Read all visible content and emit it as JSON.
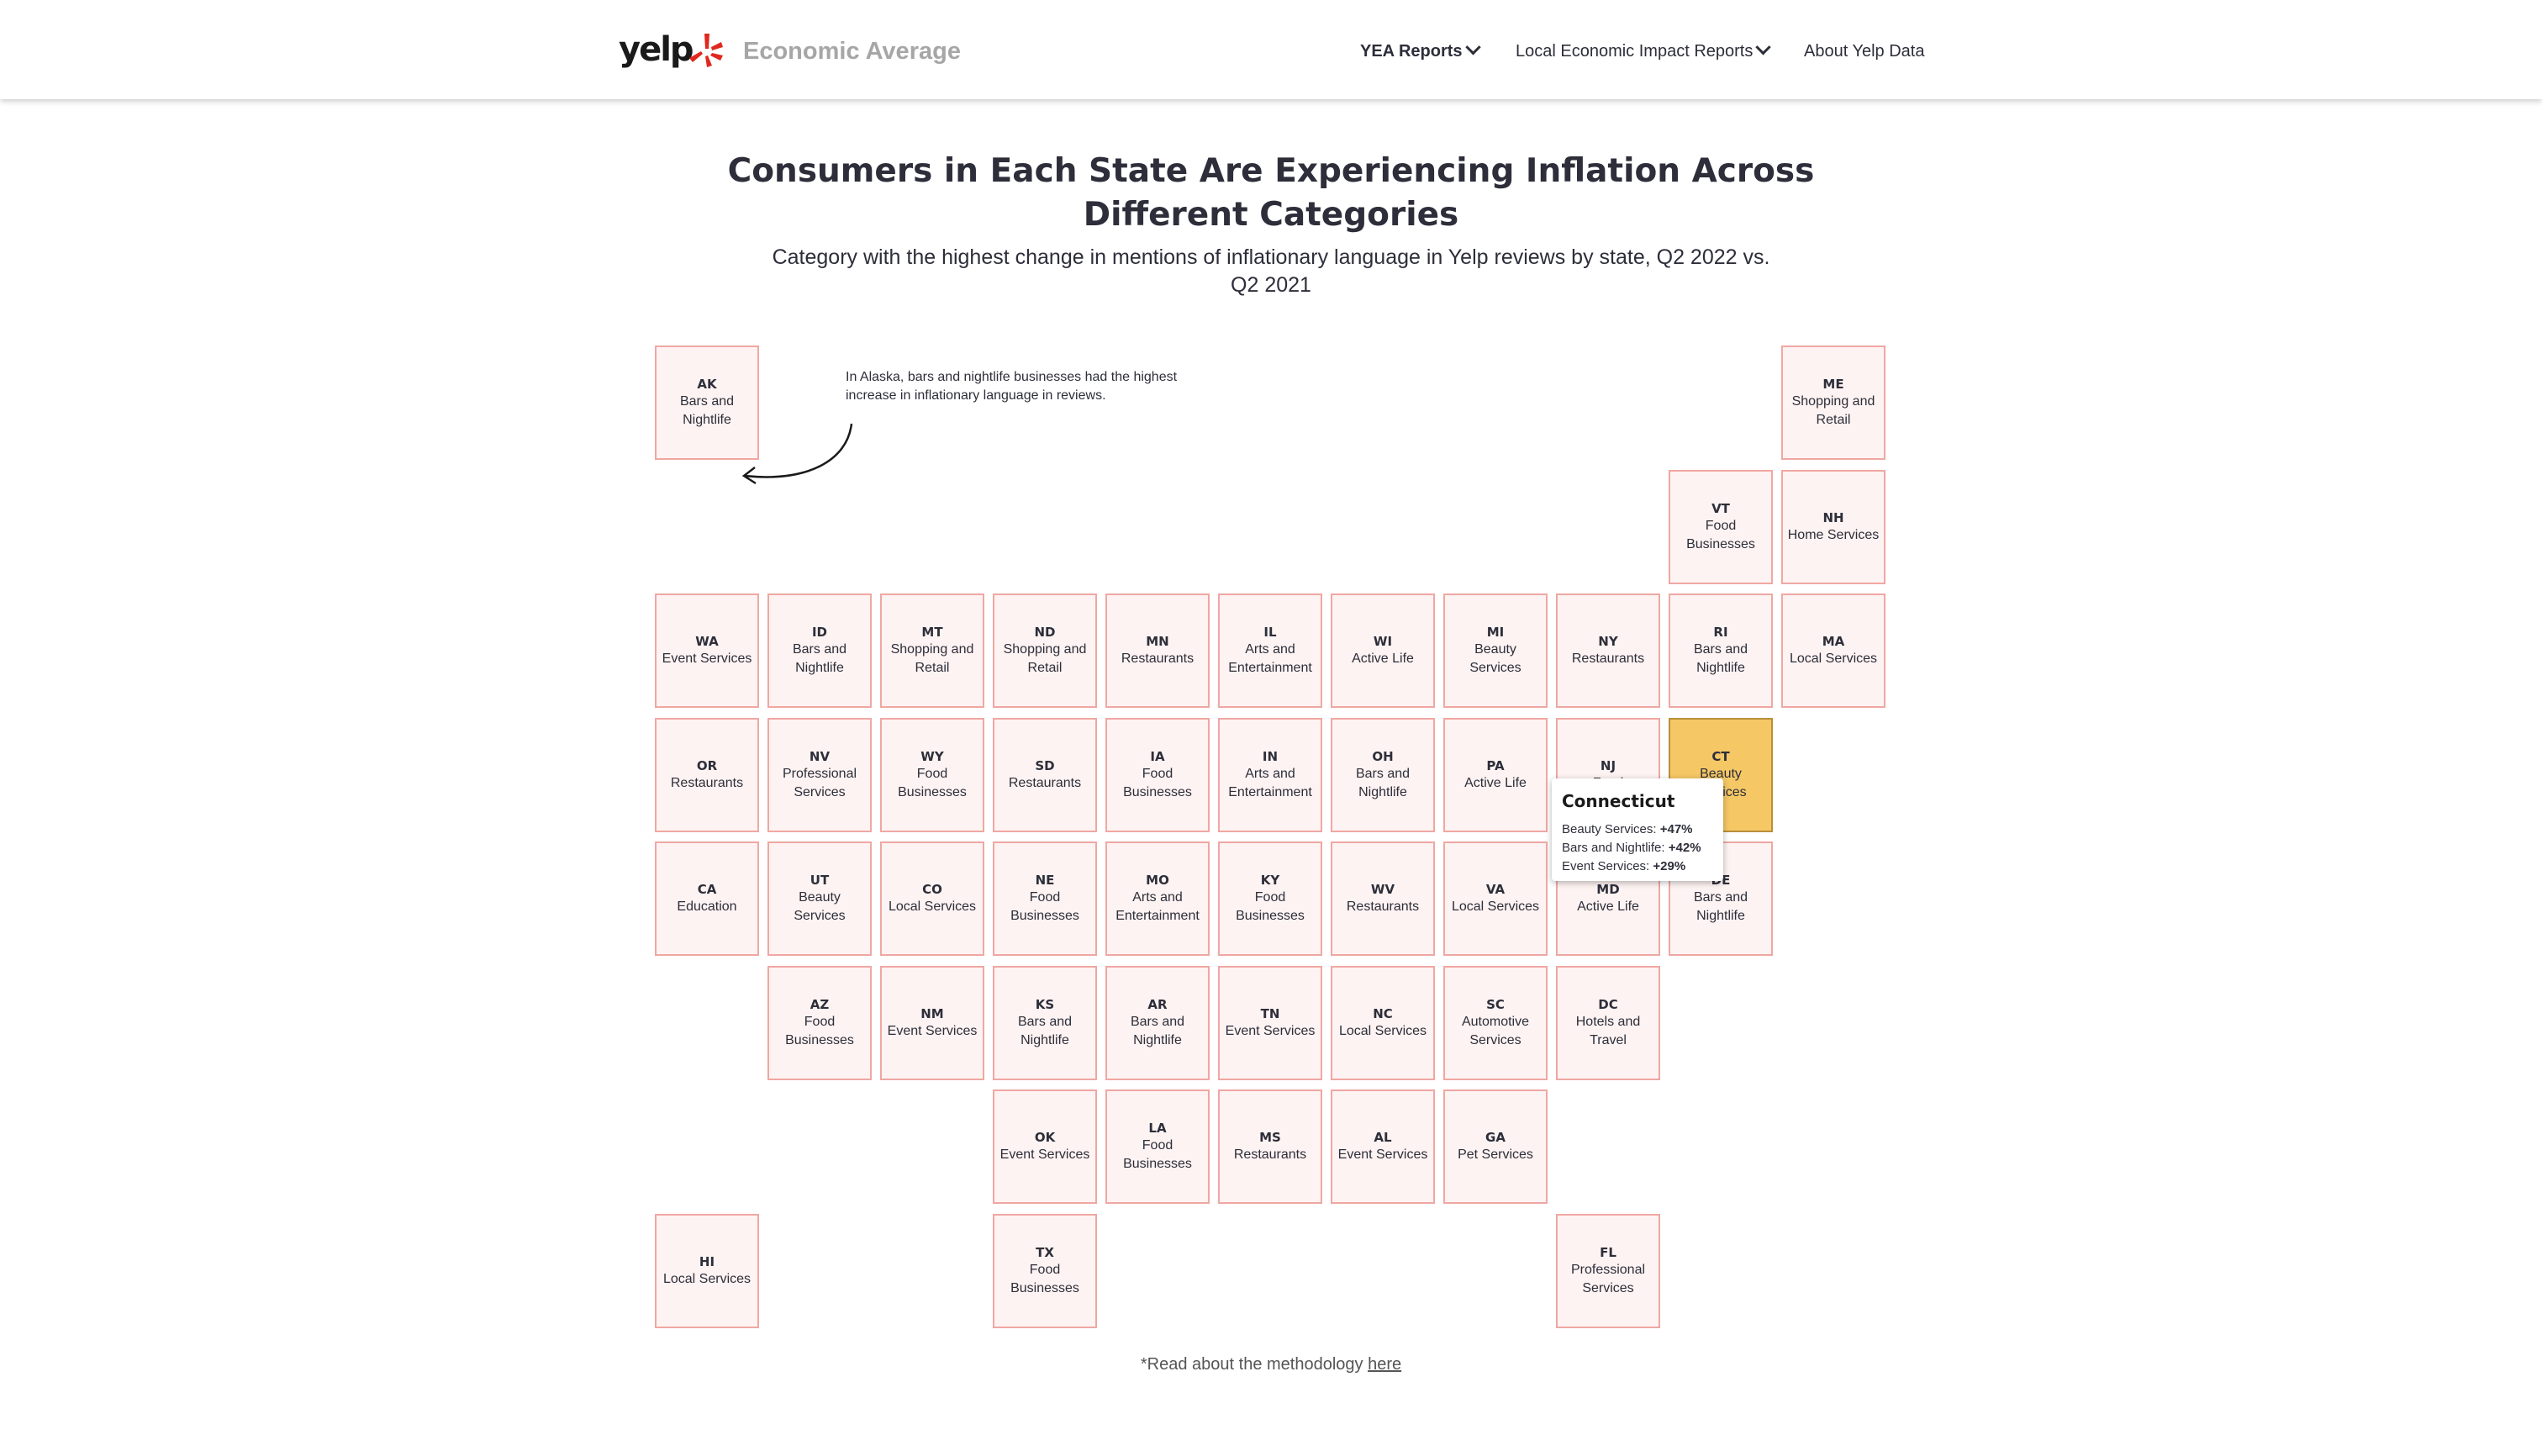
{
  "header": {
    "logo_text": "yelp",
    "site_name": "Economic Average",
    "nav": [
      {
        "label": "YEA Reports"
      },
      {
        "label": "Local Economic Impact Reports"
      },
      {
        "label": "About Yelp Data"
      }
    ]
  },
  "title": "Consumers in Each State Are Experiencing Inflation Across Different Categories",
  "subtitle": "Category with the highest change in mentions of inflationary language in Yelp reviews by state, Q2 2022 vs. Q2 2021",
  "annotation": "In Alaska, bars and nightlife businesses had the highest increase in inflationary language in reviews.",
  "colors": {
    "tile_fill": "#fdf3f2",
    "tile_border": "#f0a7a2",
    "active_fill": "#f5c865",
    "brand_red": "#e0281f"
  },
  "states": [
    {
      "abbr": "AK",
      "category": "Bars and Nightlife"
    },
    {
      "abbr": "ME",
      "category": "Shopping and Retail"
    },
    {
      "abbr": "VT",
      "category": "Food Businesses"
    },
    {
      "abbr": "NH",
      "category": "Home Services"
    },
    {
      "abbr": "WA",
      "category": "Event Services"
    },
    {
      "abbr": "ID",
      "category": "Bars and Nightlife"
    },
    {
      "abbr": "MT",
      "category": "Shopping and Retail"
    },
    {
      "abbr": "ND",
      "category": "Shopping and Retail"
    },
    {
      "abbr": "MN",
      "category": "Restaurants"
    },
    {
      "abbr": "IL",
      "category": "Arts and Entertainment"
    },
    {
      "abbr": "WI",
      "category": "Active Life"
    },
    {
      "abbr": "MI",
      "category": "Beauty Services"
    },
    {
      "abbr": "NY",
      "category": "Restaurants"
    },
    {
      "abbr": "RI",
      "category": "Bars and Nightlife"
    },
    {
      "abbr": "MA",
      "category": "Local Services"
    },
    {
      "abbr": "OR",
      "category": "Restaurants"
    },
    {
      "abbr": "NV",
      "category": "Professional Services"
    },
    {
      "abbr": "WY",
      "category": "Food Businesses"
    },
    {
      "abbr": "SD",
      "category": "Restaurants"
    },
    {
      "abbr": "IA",
      "category": "Food Businesses"
    },
    {
      "abbr": "IN",
      "category": "Arts and Entertainment"
    },
    {
      "abbr": "OH",
      "category": "Bars and Nightlife"
    },
    {
      "abbr": "PA",
      "category": "Active Life"
    },
    {
      "abbr": "NJ",
      "category": "Food"
    },
    {
      "abbr": "CT",
      "category": "Beauty Services",
      "highlighted": true
    },
    {
      "abbr": "CA",
      "category": "Education"
    },
    {
      "abbr": "UT",
      "category": "Beauty Services"
    },
    {
      "abbr": "CO",
      "category": "Local Services"
    },
    {
      "abbr": "NE",
      "category": "Food Businesses"
    },
    {
      "abbr": "MO",
      "category": "Arts and Entertainment"
    },
    {
      "abbr": "KY",
      "category": "Food Businesses"
    },
    {
      "abbr": "WV",
      "category": "Restaurants"
    },
    {
      "abbr": "VA",
      "category": "Local Services"
    },
    {
      "abbr": "MD",
      "category": "Active Life"
    },
    {
      "abbr": "DE",
      "category": "Bars and Nightlife"
    },
    {
      "abbr": "AZ",
      "category": "Food Businesses"
    },
    {
      "abbr": "NM",
      "category": "Event Services"
    },
    {
      "abbr": "KS",
      "category": "Bars and Nightlife"
    },
    {
      "abbr": "AR",
      "category": "Bars and Nightlife"
    },
    {
      "abbr": "TN",
      "category": "Event Services"
    },
    {
      "abbr": "NC",
      "category": "Local Services"
    },
    {
      "abbr": "SC",
      "category": "Automotive Services"
    },
    {
      "abbr": "DC",
      "category": "Hotels and Travel"
    },
    {
      "abbr": "OK",
      "category": "Event Services"
    },
    {
      "abbr": "LA",
      "category": "Food Businesses"
    },
    {
      "abbr": "MS",
      "category": "Restaurants"
    },
    {
      "abbr": "AL",
      "category": "Event Services"
    },
    {
      "abbr": "GA",
      "category": "Pet Services"
    },
    {
      "abbr": "HI",
      "category": "Local Services"
    },
    {
      "abbr": "TX",
      "category": "Food Businesses"
    },
    {
      "abbr": "FL",
      "category": "Professional Services"
    }
  ],
  "tooltip": {
    "title": "Connecticut",
    "rows": [
      {
        "label": "Beauty Services:",
        "value": "+47%"
      },
      {
        "label": "Bars and Nightlife:",
        "value": "+42%"
      },
      {
        "label": "Event Services:",
        "value": "+29%"
      }
    ]
  },
  "footnote": {
    "text": "*Read about the methodology ",
    "link": "here"
  }
}
